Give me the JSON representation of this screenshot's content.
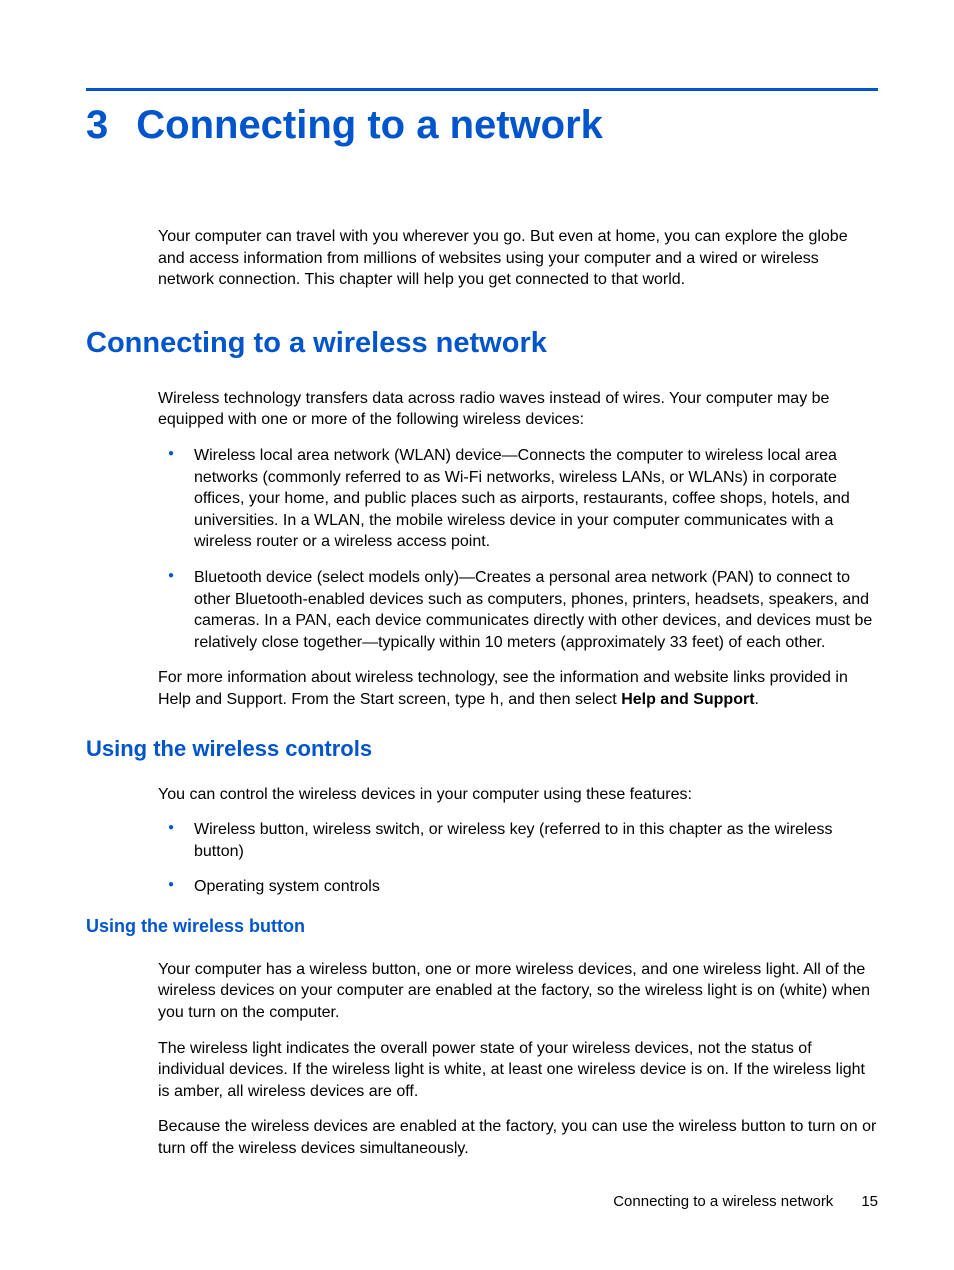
{
  "chapter": {
    "number": "3",
    "title": "Connecting to a network"
  },
  "intro": "Your computer can travel with you wherever you go. But even at home, you can explore the globe and access information from millions of websites using your computer and a wired or wireless network connection. This chapter will help you get connected to that world.",
  "section1": {
    "title": "Connecting to a wireless network",
    "para1": "Wireless technology transfers data across radio waves instead of wires. Your computer may be equipped with one or more of the following wireless devices:",
    "bullets": [
      "Wireless local area network (WLAN) device—Connects the computer to wireless local area networks (commonly referred to as Wi-Fi networks, wireless LANs, or WLANs) in corporate offices, your home, and public places such as airports, restaurants, coffee shops, hotels, and universities. In a WLAN, the mobile wireless device in your computer communicates with a wireless router or a wireless access point.",
      "Bluetooth device (select models only)—Creates a personal area network (PAN) to connect to other Bluetooth-enabled devices such as computers, phones, printers, headsets, speakers, and cameras. In a PAN, each device communicates directly with other devices, and devices must be relatively close together—typically within 10 meters (approximately 33 feet) of each other."
    ],
    "para2_pre": "For more information about wireless technology, see the information and website links provided in Help and Support. From the Start screen, type ",
    "para2_mono": "h",
    "para2_mid": ", and then select ",
    "para2_bold": "Help and Support",
    "para2_post": "."
  },
  "section2": {
    "title": "Using the wireless controls",
    "para1": "You can control the wireless devices in your computer using these features:",
    "bullets": [
      "Wireless button, wireless switch, or wireless key (referred to in this chapter as the wireless button)",
      "Operating system controls"
    ]
  },
  "section3": {
    "title": "Using the wireless button",
    "para1": "Your computer has a wireless button, one or more wireless devices, and one wireless light. All of the wireless devices on your computer are enabled at the factory, so the wireless light is on (white) when you turn on the computer.",
    "para2": "The wireless light indicates the overall power state of your wireless devices, not the status of individual devices. If the wireless light is white, at least one wireless device is on. If the wireless light is amber, all wireless devices are off.",
    "para3": "Because the wireless devices are enabled at the factory, you can use the wireless button to turn on or turn off the wireless devices simultaneously."
  },
  "footer": {
    "text": "Connecting to a wireless network",
    "page": "15"
  }
}
